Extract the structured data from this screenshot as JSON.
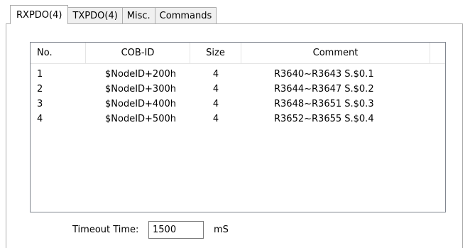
{
  "tabs": [
    {
      "label": "RXPDO(4)",
      "active": true
    },
    {
      "label": "TXPDO(4)",
      "active": false
    },
    {
      "label": "Misc.",
      "active": false
    },
    {
      "label": "Commands",
      "active": false
    }
  ],
  "table": {
    "columns": [
      "No.",
      "COB-ID",
      "Size",
      "Comment"
    ],
    "rows": [
      {
        "no": "1",
        "cob_id": "$NodeID+200h",
        "size": "4",
        "comment": "R3640~R3643 S.$0.1"
      },
      {
        "no": "2",
        "cob_id": "$NodeID+300h",
        "size": "4",
        "comment": "R3644~R3647 S.$0.2"
      },
      {
        "no": "3",
        "cob_id": "$NodeID+400h",
        "size": "4",
        "comment": "R3648~R3651 S.$0.3"
      },
      {
        "no": "4",
        "cob_id": "$NodeID+500h",
        "size": "4",
        "comment": "R3652~R3655 S.$0.4"
      }
    ]
  },
  "timeout": {
    "label": "Timeout Time:",
    "value": "1500",
    "unit": "mS"
  }
}
